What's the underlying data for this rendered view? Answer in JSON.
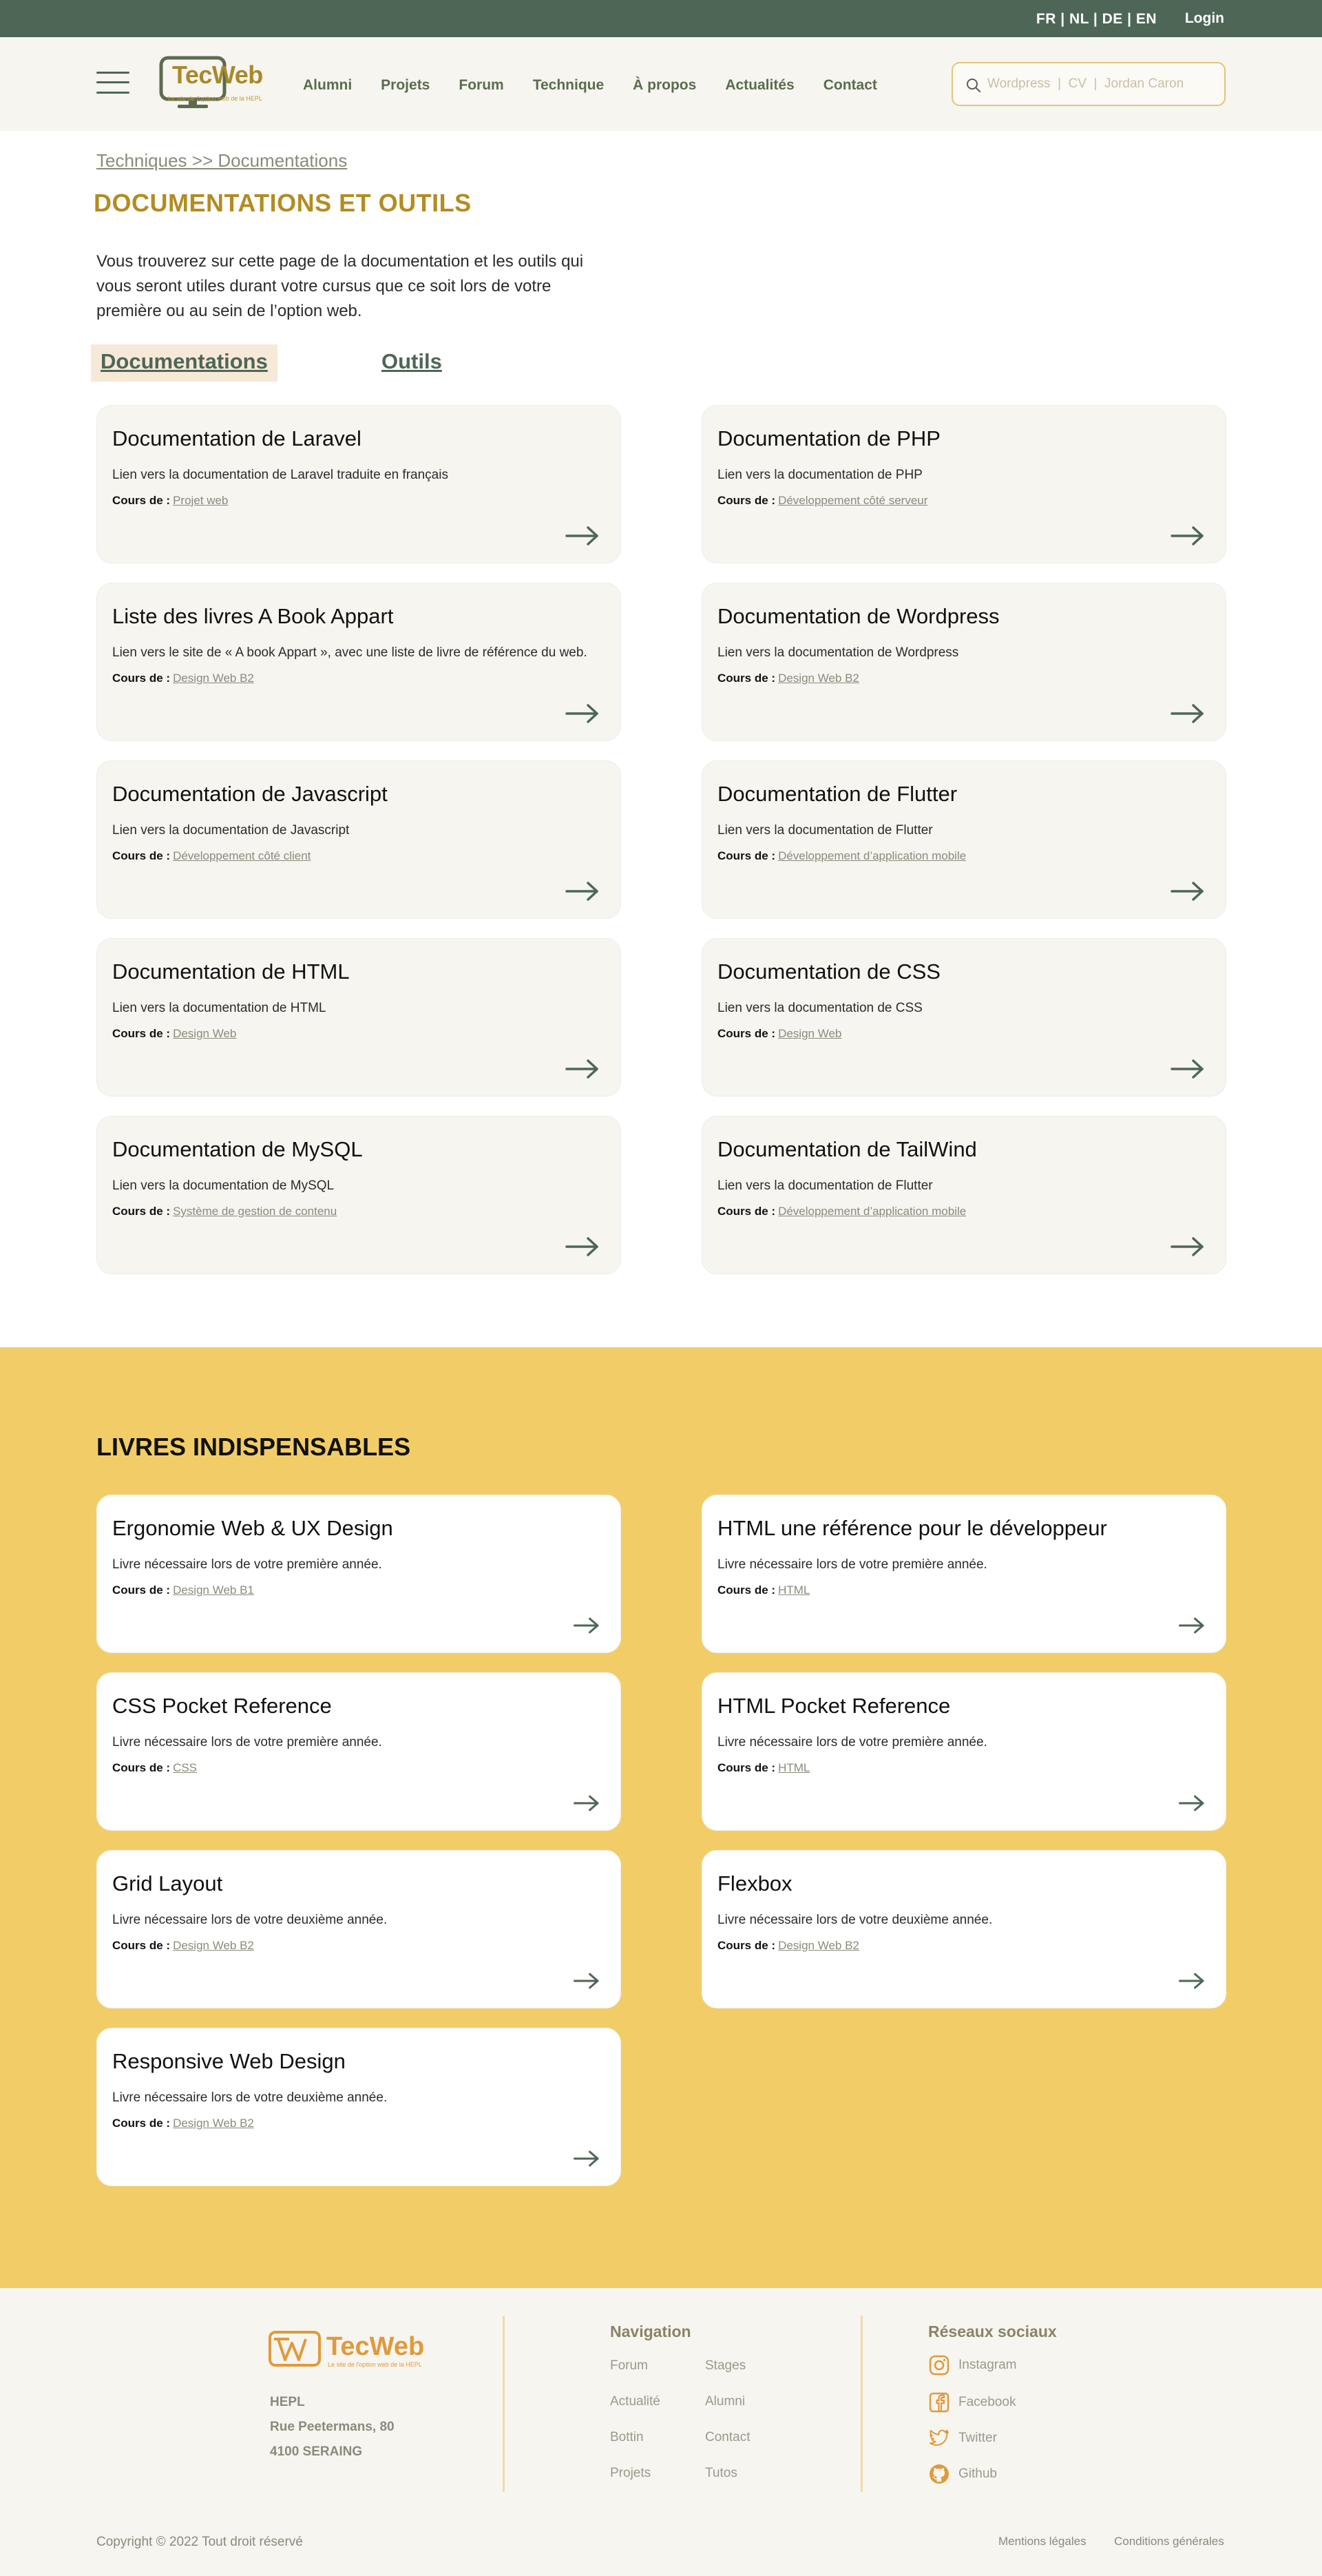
{
  "topbar": {
    "languages": "FR | NL | DE | EN",
    "login": "Login"
  },
  "header": {
    "logo_text": "TecWeb",
    "logo_subtitle": "Le site de l'option web de la HEPL",
    "nav": [
      "Alumni",
      "Projets",
      "Forum",
      "Technique",
      "À propos",
      "Actualités",
      "Contact"
    ],
    "search_placeholder": "Wordpress  |  CV  |  Jordan Caron"
  },
  "main": {
    "breadcrumb": "Techniques >> Documentations",
    "title": "DOCUMENTATIONS ET OUTILS",
    "intro": "Vous trouverez sur cette page de la documentation et les outils qui vous seront utiles durant votre cursus que ce soit lors de votre première ou au sein de l’option web.",
    "tabs": {
      "docs": "Documentations",
      "tools": "Outils"
    },
    "course_label": "Cours de :",
    "docs": [
      {
        "title": "Documentation de Laravel",
        "desc": "Lien vers la documentation de Laravel traduite en français",
        "course": "Projet web"
      },
      {
        "title": "Documentation de PHP",
        "desc": "Lien vers la documentation de PHP",
        "course": "Développement côté serveur"
      },
      {
        "title": "Liste des livres A Book Appart",
        "desc": "Lien vers le site de « A book Appart », avec une liste de livre de référence du web.",
        "course": "Design Web B2"
      },
      {
        "title": "Documentation de Wordpress",
        "desc": "Lien vers la documentation de Wordpress",
        "course": "Design Web B2"
      },
      {
        "title": "Documentation de Javascript",
        "desc": "Lien vers la documentation de Javascript",
        "course": "Développement côté client"
      },
      {
        "title": "Documentation de Flutter",
        "desc": "Lien vers la documentation de Flutter",
        "course": "Développement d’application mobile"
      },
      {
        "title": "Documentation de HTML",
        "desc": "Lien vers la documentation de HTML",
        "course": "Design Web"
      },
      {
        "title": "Documentation de CSS",
        "desc": "Lien vers la documentation de CSS",
        "course": "Design Web"
      },
      {
        "title": "Documentation de MySQL",
        "desc": "Lien vers la documentation de MySQL",
        "course": "Système de gestion de contenu"
      },
      {
        "title": "Documentation de TailWind",
        "desc": "Lien vers la documentation de Flutter",
        "course": "Développement d’application mobile"
      }
    ]
  },
  "books": {
    "title": "LIVRES INDISPENSABLES",
    "items": [
      {
        "title": "Ergonomie Web & UX Design",
        "desc": "Livre nécessaire lors de votre première année.",
        "course": "Design Web B1"
      },
      {
        "title": "HTML une référence pour le développeur",
        "desc": "Livre nécessaire lors de votre première année.",
        "course": "HTML"
      },
      {
        "title": "CSS Pocket Reference",
        "desc": "Livre nécessaire lors de votre première année.",
        "course": "CSS"
      },
      {
        "title": "HTML Pocket Reference",
        "desc": "Livre nécessaire lors de votre première année.",
        "course": "HTML"
      },
      {
        "title": "Grid Layout",
        "desc": "Livre nécessaire lors de votre deuxième année.",
        "course": "Design Web B2"
      },
      {
        "title": "Flexbox",
        "desc": "Livre nécessaire lors de votre deuxième année.",
        "course": "Design Web B2"
      },
      {
        "title": "Responsive Web Design",
        "desc": "Livre nécessaire lors de votre deuxième année.",
        "course": "Design Web B2"
      }
    ]
  },
  "footer": {
    "logo_text": "TecWeb",
    "logo_subtitle": "Le site de l'option web de la HEPL",
    "address": [
      "HEPL",
      "Rue Peetermans, 80",
      "4100 SERAING"
    ],
    "nav_title": "Navigation",
    "nav_col1": [
      "Forum",
      "Actualité",
      "Bottin",
      "Projets"
    ],
    "nav_col2": [
      "Stages",
      "Alumni",
      "Contact",
      "Tutos"
    ],
    "social_title": "Réseaux sociaux",
    "social": [
      "Instagram",
      "Facebook",
      "Twitter",
      "Github"
    ],
    "copyright": "Copyright © 2022 Tout droit réservé",
    "legal": [
      "Mentions légales",
      "Conditions générales"
    ]
  },
  "colors": {
    "topbar": "#4e6656",
    "accent_gold": "#b38c21",
    "books_bg": "#f2cd67",
    "footer_orange": "#e09a3b"
  }
}
